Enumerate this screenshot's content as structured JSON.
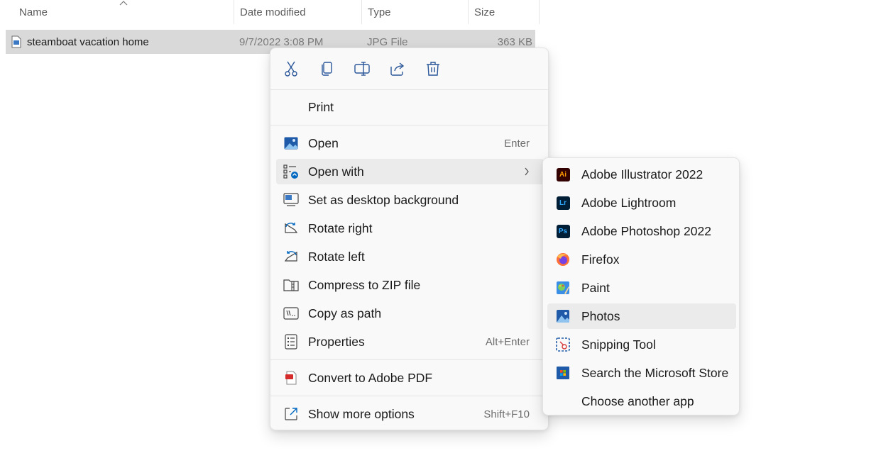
{
  "columns": {
    "name": "Name",
    "date_modified": "Date modified",
    "type": "Type",
    "size": "Size"
  },
  "file": {
    "name": "steamboat vacation home",
    "date_modified": "9/7/2022 3:08 PM",
    "type": "JPG File",
    "size": "363 KB"
  },
  "toolbar_icons": [
    "cut-icon",
    "copy-icon",
    "rename-icon",
    "share-icon",
    "delete-icon"
  ],
  "menu": {
    "print": "Print",
    "open": "Open",
    "open_accel": "Enter",
    "open_with": "Open with",
    "set_background": "Set as desktop background",
    "rotate_right": "Rotate right",
    "rotate_left": "Rotate left",
    "compress": "Compress to ZIP file",
    "copy_path": "Copy as path",
    "properties": "Properties",
    "properties_accel": "Alt+Enter",
    "convert_pdf": "Convert to Adobe PDF",
    "more_options": "Show more options",
    "more_options_accel": "Shift+F10"
  },
  "open_with_apps": [
    {
      "label": "Adobe Illustrator 2022",
      "icon": "illustrator-icon",
      "badge": "Ai",
      "color": "#ff9a00",
      "bg": "#330000"
    },
    {
      "label": "Adobe Lightroom",
      "icon": "lightroom-icon",
      "badge": "Lr",
      "color": "#31a8ff",
      "bg": "#001e36"
    },
    {
      "label": "Adobe Photoshop 2022",
      "icon": "photoshop-icon",
      "badge": "Ps",
      "color": "#31a8ff",
      "bg": "#001e36"
    },
    {
      "label": "Firefox",
      "icon": "firefox-icon"
    },
    {
      "label": "Paint",
      "icon": "paint-icon"
    },
    {
      "label": "Photos",
      "icon": "photos-icon"
    },
    {
      "label": "Snipping Tool",
      "icon": "snipping-tool-icon"
    },
    {
      "label": "Search the Microsoft Store",
      "icon": "microsoft-store-icon"
    },
    {
      "label": "Choose another app",
      "icon": ""
    }
  ],
  "colors": {
    "accent": "#0067c0",
    "selection": "#d9d9d9",
    "menu_bg": "#f9f9f9",
    "hover": "#ebebeb"
  }
}
